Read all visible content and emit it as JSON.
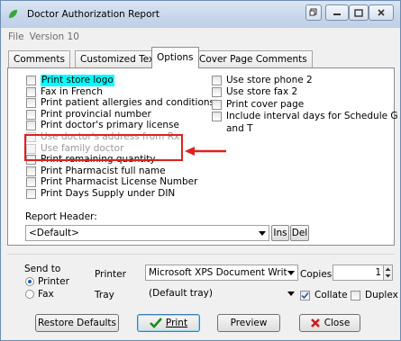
{
  "window": {
    "title": "Doctor Authorization Report",
    "colors": {
      "titlebar": "#c7d6ea",
      "accent": "#3c7fb1",
      "highlight": "#00ffff",
      "annotation": "#e02020"
    }
  },
  "menu": [
    "File",
    "Version 10"
  ],
  "tabs": [
    "Comments",
    "Customized Text",
    "Options",
    "Cover Page Comments"
  ],
  "active_tab": "Options",
  "options_left": [
    {
      "label": "Print store logo",
      "checked": false,
      "highlighted": true,
      "disabled": false
    },
    {
      "label": "Fax in French",
      "checked": false,
      "highlighted": false,
      "disabled": false
    },
    {
      "label": "Print patient allergies and conditions",
      "checked": false,
      "highlighted": false,
      "disabled": false
    },
    {
      "label": "Print provincial number",
      "checked": false,
      "highlighted": false,
      "disabled": false
    },
    {
      "label": "Print doctor's primary license",
      "checked": false,
      "highlighted": false,
      "disabled": false
    },
    {
      "label": "Use doctor's address from Rx",
      "checked": false,
      "highlighted": false,
      "disabled": true
    },
    {
      "label": "Use family doctor",
      "checked": false,
      "highlighted": false,
      "disabled": true
    },
    {
      "label": "Print remaining quantity",
      "checked": false,
      "highlighted": false,
      "disabled": false
    },
    {
      "label": "Print Pharmacist full name",
      "checked": false,
      "highlighted": false,
      "disabled": false
    },
    {
      "label": "Print Pharmacist License Number",
      "checked": false,
      "highlighted": false,
      "disabled": false
    },
    {
      "label": "Print Days Supply under DIN",
      "checked": false,
      "highlighted": false,
      "disabled": false
    }
  ],
  "options_right": [
    {
      "label": "Use store phone 2",
      "checked": false
    },
    {
      "label": "Use store fax 2",
      "checked": false
    },
    {
      "label": "Print cover page",
      "checked": false
    },
    {
      "label": "Include interval days for Schedule G",
      "checked": false
    },
    {
      "label": "and T",
      "checked": false
    }
  ],
  "report_header": {
    "label": "Report Header:",
    "value": "<Default>",
    "ins": "Ins",
    "del": "Del"
  },
  "send_to": {
    "label": "Send to",
    "options": [
      "Printer",
      "Fax"
    ],
    "selected": "Printer"
  },
  "printer": {
    "label": "Printer",
    "value": "Microsoft XPS Document Writ"
  },
  "tray": {
    "label": "Tray",
    "value": "(Default tray)"
  },
  "copies": {
    "label": "Copies",
    "value": "1"
  },
  "collate": {
    "label": "Collate",
    "checked": true
  },
  "duplex": {
    "label": "Duplex",
    "checked": false
  },
  "buttons": {
    "restore": "Restore Defaults",
    "print": "Print",
    "preview": "Preview",
    "close": "Close"
  }
}
